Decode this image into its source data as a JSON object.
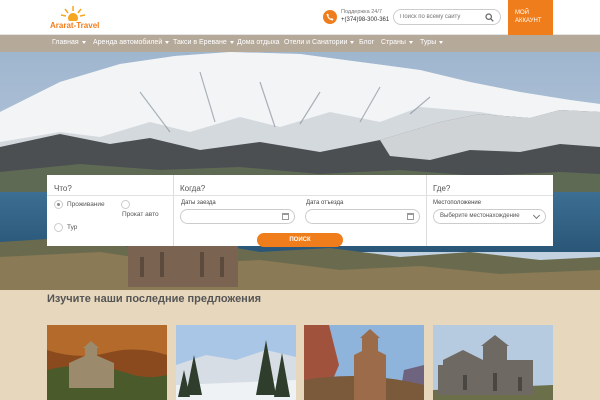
{
  "header": {
    "logo_text": "Ararat-Travel",
    "support_title": "Поддержка 24/7",
    "support_phone": "+(374)98-300-361",
    "search_placeholder": "Поиск по всему сайту",
    "account_line1": "МОЙ",
    "account_line2": "АККАУНТ"
  },
  "nav": {
    "items": [
      {
        "label": "Главная",
        "has_menu": true
      },
      {
        "label": "Аренда автомобилей",
        "has_menu": true
      },
      {
        "label": "Такси в Ереване",
        "has_menu": true
      },
      {
        "label": "Дома отдыха",
        "has_menu": false
      },
      {
        "label": "Отели и Санатории",
        "has_menu": true
      },
      {
        "label": "Блог",
        "has_menu": false
      },
      {
        "label": "Страны",
        "has_menu": true
      },
      {
        "label": "Туры",
        "has_menu": true
      }
    ]
  },
  "booking": {
    "what_title": "Что?",
    "what_options": [
      {
        "label": "Проживание",
        "checked": true
      },
      {
        "label": "Прокат авто",
        "checked": false
      },
      {
        "label": "Тур",
        "checked": false
      }
    ],
    "when_title": "Когда?",
    "checkin_label": "Даты заезда",
    "checkout_label": "Дата отъезда",
    "where_title": "Где?",
    "location_label": "Местоположение",
    "location_placeholder": "Выберите местонахождение",
    "search_label": "ПОИСК"
  },
  "offers": {
    "title": "Изучите наши последние предложения",
    "cards": [
      "monastery-autumn",
      "snowy-forest",
      "church-canyon",
      "monastery-stone"
    ]
  },
  "colors": {
    "accent": "#f07d1b",
    "nav_bg": "#b5a99a",
    "offers_bg": "#e7d7bd"
  }
}
